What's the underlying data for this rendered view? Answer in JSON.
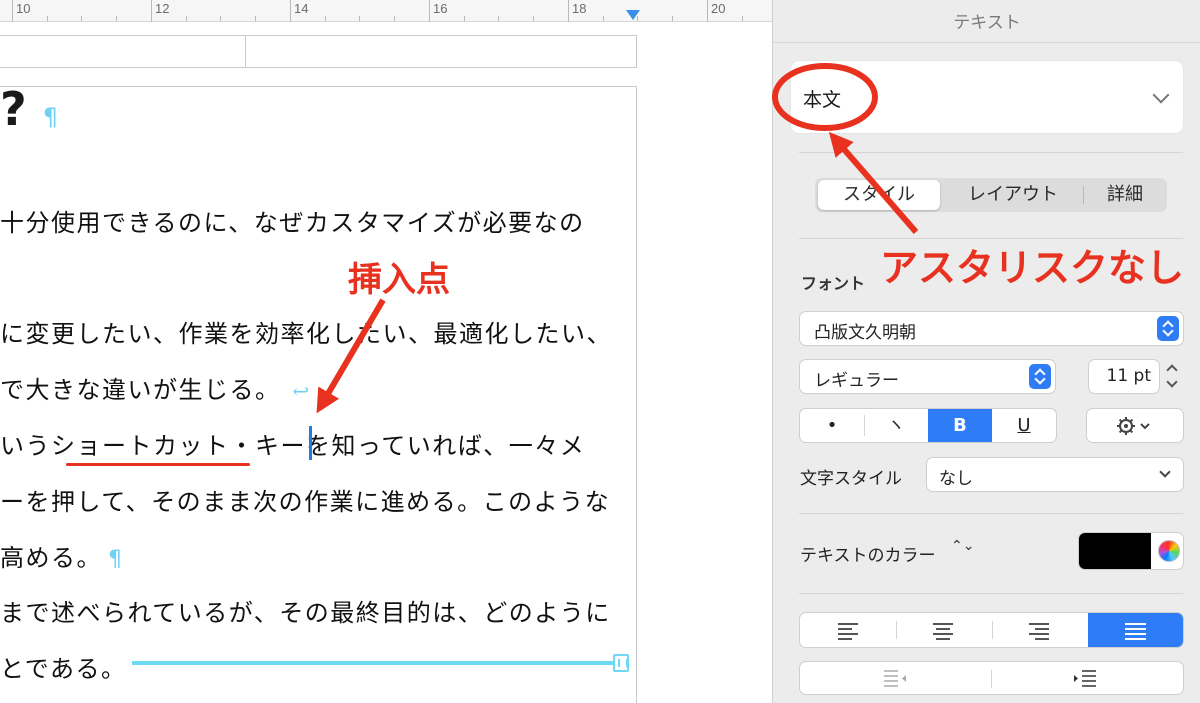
{
  "ruler": {
    "labels": [
      "10",
      "12",
      "14",
      "16",
      "18",
      "20"
    ]
  },
  "document": {
    "heading": "?",
    "pilcrow": "¶",
    "return_mark": "↩",
    "lines": [
      "十分使用できるのに、なぜカスタマイズが必要なの",
      "に変更したい、作業を効率化したい、最適化したい、",
      "で大きな違いが生じる。",
      "いうショートカット・キーを知っていれば、一々メ",
      "ーを押して、そのまま次の作業に進める。このような",
      "高める。",
      "まで述べられているが、その最終目的は、どのように",
      "とである。"
    ]
  },
  "annotations": {
    "insertion_point": "挿入点",
    "no_asterisk": "アスタリスクなし"
  },
  "inspector": {
    "title": "テキスト",
    "paragraph_style": "本文",
    "tabs": [
      {
        "label": "スタイル"
      },
      {
        "label": "レイアウト"
      },
      {
        "label": "詳細"
      }
    ],
    "font_section_label": "フォント",
    "font_family": "凸版文久明朝",
    "font_weight": "レギュラー",
    "font_size": "11 pt",
    "format_buttons": {
      "bullet": "•",
      "italic": "ヽ",
      "bold": "B",
      "underline": "U"
    },
    "char_style_label": "文字スタイル",
    "char_style_value": "なし",
    "text_color_label": "テキストのカラー",
    "text_color_updown": "⌃⌄",
    "text_color": "#000000",
    "active_alignment": "justify",
    "colors": {
      "accent": "#2e7cf6",
      "annotation": "#e8311e",
      "invisibles": "#6fd2f2"
    }
  }
}
